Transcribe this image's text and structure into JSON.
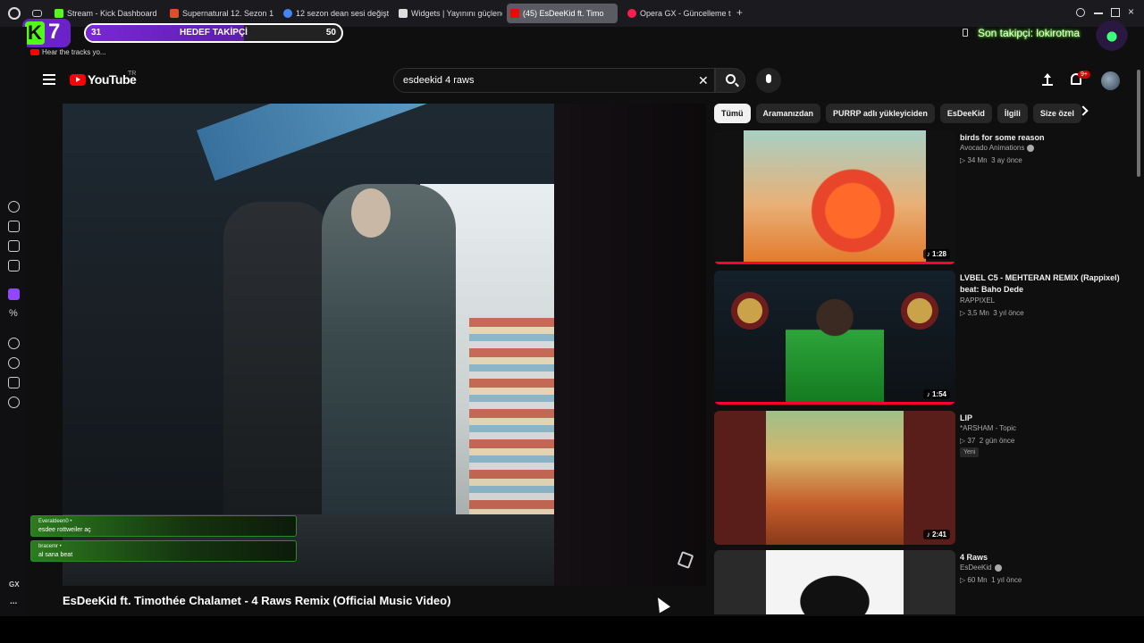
{
  "browser": {
    "tabs": [
      {
        "label": "Stream - Kick Dashboard",
        "color": "#53fc18"
      },
      {
        "label": "Supernatural 12. Sezon 1. B",
        "color": "#e34b2a"
      },
      {
        "label": "12 sezon dean sesi değişti",
        "color": "#4285f4"
      },
      {
        "label": "Widgets | Yayınını güçlend",
        "color": "#dddddd"
      },
      {
        "label": "(45) EsDeeKid ft. Timo",
        "color": "#ff0000"
      },
      {
        "label": "Opera GX - Güncelleme ta",
        "color": "#fa1e4e"
      }
    ],
    "new_tab_label": "+"
  },
  "kick_overlay": {
    "logo_letter": "K",
    "logo_number": "7",
    "goal_current": "31",
    "goal_label": "HEDEF TAKİPÇİ",
    "goal_max": "50",
    "goal_progress": 0.62,
    "hear_text": "Hear the tracks yo...",
    "last_follower": "Son takipçi: lokirotma"
  },
  "youtube": {
    "logo_text": "YouTube",
    "region": "TR",
    "search_query": "esdeekid 4 raws",
    "notification_count": "9+",
    "video_title": "EsDeeKid ft. Timothée Chalamet - 4 Raws Remix (Official Music Video)",
    "chips": [
      "Tümü",
      "Aramanızdan",
      "PURRP adlı yükleyiciden",
      "EsDeeKid",
      "İlgili",
      "Size özel"
    ],
    "recommendations": [
      {
        "title": "birds for some reason",
        "channel": "Avocado Animations",
        "verified": true,
        "views": "▷ 34 Mn",
        "age": "3 ay önce",
        "duration": "♪ 1:28",
        "watched": true
      },
      {
        "title": "LVBEL C5 - MEHTERAN REMIX (Rappixel) beat: Baho Dede",
        "channel": "RAPPIXEL",
        "verified": false,
        "views": "▷ 3,5 Mn",
        "age": "3 yıl önce",
        "duration": "♪ 1:54",
        "watched": true
      },
      {
        "title": "LIP",
        "channel": "*ARSHAM - Topic",
        "verified": false,
        "views": "▷ 37",
        "age": "2 gün önce",
        "duration": "♪ 2:41",
        "badge": "Yeni",
        "watched": false
      },
      {
        "title": "4 Raws",
        "channel": "EsDeeKid",
        "verified": true,
        "views": "▷ 60 Mn",
        "age": "1 yıl önce",
        "duration": "",
        "watched": false
      }
    ]
  },
  "chat": [
    {
      "user": "Everaldeen0 •",
      "message": "esdee rottweiler aç"
    },
    {
      "user": "bracemr •",
      "message": "al sana beat"
    }
  ],
  "sidebar_icons": [
    "refresh-icon",
    "store-icon",
    "layers-icon",
    "messenger-icon",
    "twitch-icon",
    "percent-icon",
    "player-icon",
    "history-icon",
    "extensions-icon",
    "settings-icon"
  ],
  "sidebar_bottom": {
    "gx_label": "GX",
    "more_label": "..."
  }
}
